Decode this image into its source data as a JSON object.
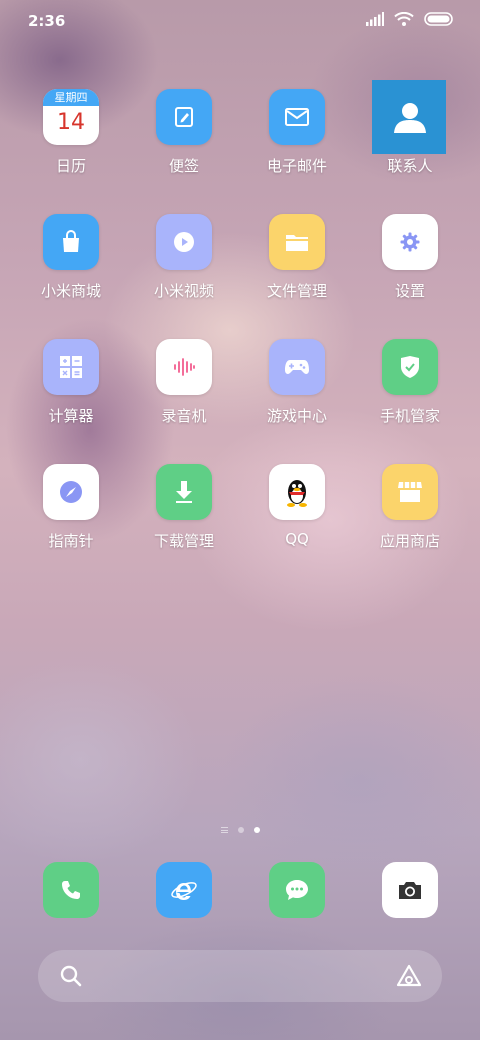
{
  "status_bar": {
    "time": "2:36"
  },
  "calendar": {
    "weekday": "星期四",
    "day": "14"
  },
  "apps": [
    {
      "label": "日历"
    },
    {
      "label": "便签"
    },
    {
      "label": "电子邮件"
    },
    {
      "label": "联系人"
    },
    {
      "label": "小米商城"
    },
    {
      "label": "小米视频"
    },
    {
      "label": "文件管理"
    },
    {
      "label": "设置"
    },
    {
      "label": "计算器"
    },
    {
      "label": "录音机"
    },
    {
      "label": "游戏中心"
    },
    {
      "label": "手机管家"
    },
    {
      "label": "指南针"
    },
    {
      "label": "下载管理"
    },
    {
      "label": "QQ"
    },
    {
      "label": "应用商店"
    }
  ],
  "dock": [
    "phone-icon",
    "browser-icon",
    "messages-icon",
    "camera-icon"
  ],
  "colors": {
    "blue": "#44a7f5",
    "periwinkle": "#a9b4fb",
    "yellow": "#fbd46b",
    "green": "#5fcf86",
    "white": "#ffffff",
    "selection": "#2a92d3"
  }
}
